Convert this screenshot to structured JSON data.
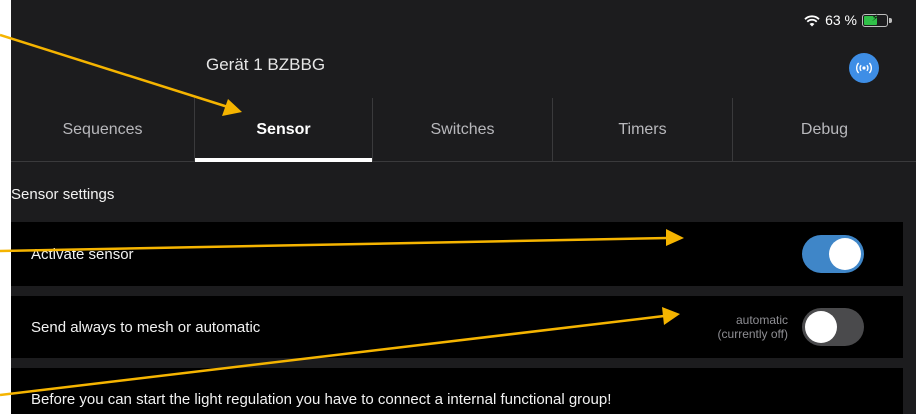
{
  "status_bar": {
    "battery_text": "63 %",
    "battery_level": 0.63,
    "wifi_icon": "wifi-icon",
    "battery_icon": "battery-charging-icon"
  },
  "nav": {
    "title": "Gerät 1 BZBBG",
    "bluetooth_icon": "bluetooth-broadcast-icon",
    "accent": "#3e8ee6"
  },
  "tabs": [
    {
      "label": "Sequences",
      "active": false
    },
    {
      "label": "Sensor",
      "active": true
    },
    {
      "label": "Switches",
      "active": false
    },
    {
      "label": "Timers",
      "active": false
    },
    {
      "label": "Debug",
      "active": false
    }
  ],
  "sensor": {
    "section_title": "Sensor settings",
    "activate": {
      "label": "Activate sensor",
      "on": true
    },
    "mesh": {
      "label": "Send always to mesh or automatic",
      "status_line1": "automatic",
      "status_line2": "(currently off)",
      "on": false
    },
    "info": "Before you can start the light regulation you have to connect a internal functional group!"
  },
  "colors": {
    "background": "#1c1c1e",
    "row_background": "#000000",
    "toggle_on": "#3f86c8",
    "toggle_off": "#4a4a4c",
    "annotation_arrow": "#f5b400"
  }
}
